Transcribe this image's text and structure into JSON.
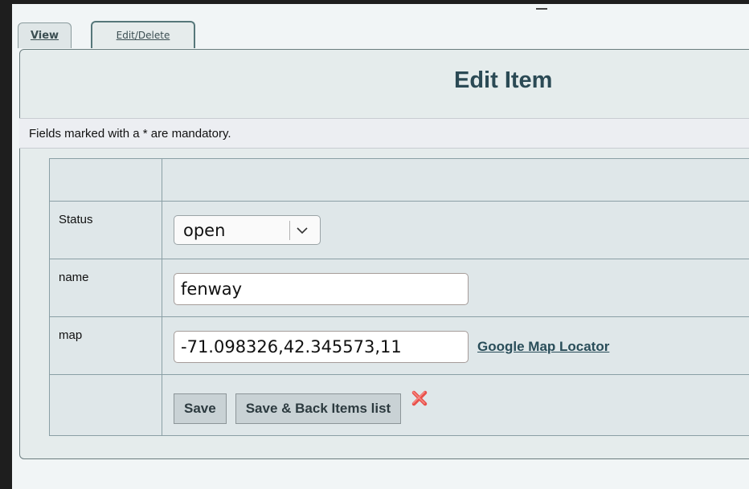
{
  "tabs": {
    "view_label": "View",
    "edit_label": "Edit/Delete"
  },
  "panel": {
    "title": "Edit Item",
    "mandatory_note": "Fields marked with a * are mandatory."
  },
  "form": {
    "status": {
      "label": "Status",
      "value": "open"
    },
    "name": {
      "label": "name",
      "value": "fenway"
    },
    "map": {
      "label": "map",
      "value": "-71.098326,42.345573,11",
      "link_label": "Google Map Locator"
    },
    "buttons": {
      "save_label": "Save",
      "save_back_label": "Save & Back Items list"
    }
  },
  "icons": {
    "select_chevron": "chevron-down-icon",
    "delete": "close-icon"
  },
  "colors": {
    "title": "#2b4a55",
    "link": "#294d59",
    "delete_icon": "#e8504a"
  }
}
